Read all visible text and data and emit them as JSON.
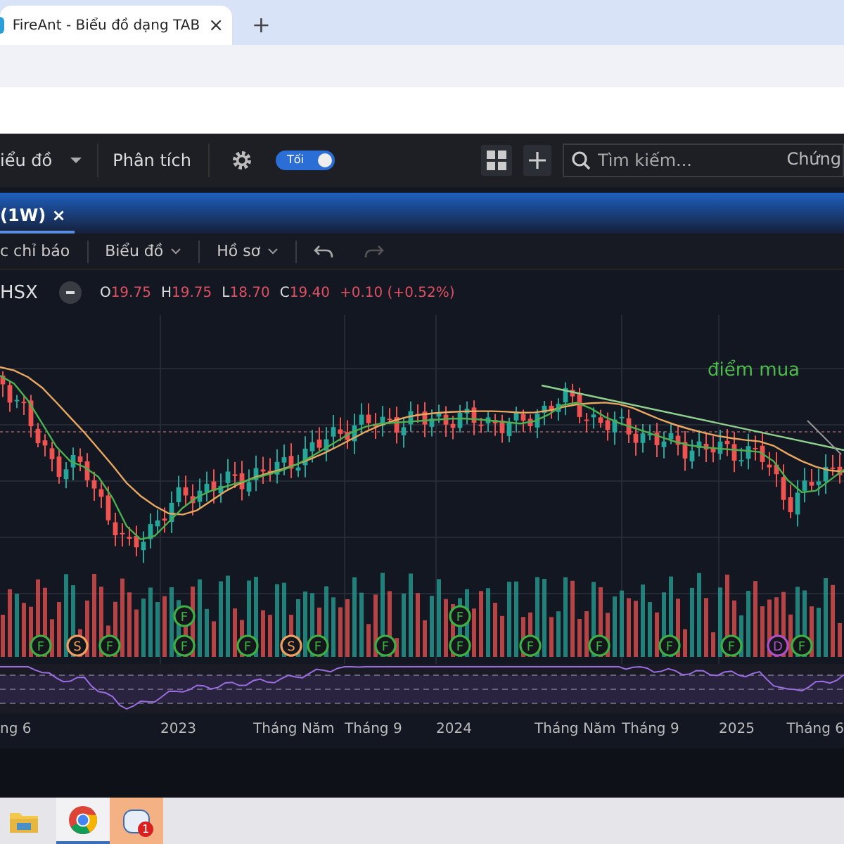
{
  "browser": {
    "tab_title": "FireAnt - Biểu đồ dạng TAB",
    "close": "×",
    "new_tab": "+"
  },
  "toolbar": {
    "chart_menu": "iểu đồ",
    "analysis": "Phân tích",
    "theme_toggle": {
      "label": "Tối",
      "on": true
    },
    "search": {
      "placeholder": "Tìm kiếm..."
    },
    "filter": "Chứng"
  },
  "chart_tab": {
    "label": "(1W)",
    "close": "×"
  },
  "chart_toolbar": {
    "indicators": "c chỉ báo",
    "chart_type": "Biểu đồ",
    "profile": "Hồ sơ"
  },
  "legend": {
    "exchange": "HSX",
    "ohlc": [
      {
        "label": "O",
        "value": "19.75"
      },
      {
        "label": "H",
        "value": "19.75"
      },
      {
        "label": "L",
        "value": "18.70"
      },
      {
        "label": "C",
        "value": "19.40"
      }
    ],
    "change": "+0.10 (+0.52%)"
  },
  "annotation": "điểm mua",
  "events": [
    {
      "label": "F",
      "color": "#3cb043"
    },
    {
      "label": "F",
      "color": "#3cb043"
    },
    {
      "label": "F",
      "color": "#3cb043"
    },
    {
      "label": "S",
      "color": "#f0a060"
    },
    {
      "label": "F",
      "color": "#3cb043"
    },
    {
      "label": "F",
      "color": "#3cb043"
    },
    {
      "label": "F",
      "color": "#3cb043"
    },
    {
      "label": "S",
      "color": "#f0a060"
    },
    {
      "label": "F",
      "color": "#3cb043"
    },
    {
      "label": "F",
      "color": "#3cb043"
    },
    {
      "label": "F",
      "color": "#3cb043"
    },
    {
      "label": "F",
      "color": "#3cb043"
    },
    {
      "label": "F",
      "color": "#3cb043"
    },
    {
      "label": "F",
      "color": "#3cb043"
    },
    {
      "label": "F",
      "color": "#3cb043"
    },
    {
      "label": "D",
      "color": "#b050c8"
    },
    {
      "label": "F",
      "color": "#3cb043"
    }
  ],
  "x_axis": [
    "ng 6",
    "2023",
    "Tháng Năm",
    "Tháng 9",
    "2024",
    "Tháng Năm",
    "Tháng 9",
    "2025",
    "Tháng 6"
  ],
  "taskbar": {
    "badge": "1"
  }
}
